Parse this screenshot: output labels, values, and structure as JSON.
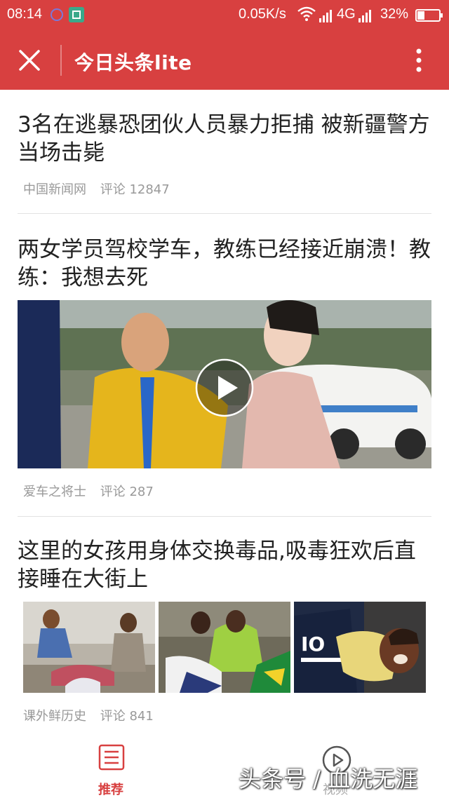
{
  "status_bar": {
    "time": "08:14",
    "network_speed": "0.05K/s",
    "network_type": "4G",
    "battery": "32%",
    "icons": [
      "circle-notification-icon",
      "scan-icon",
      "wifi-icon",
      "signal-icon",
      "battery-icon"
    ]
  },
  "app_bar": {
    "title": "今日头条lite",
    "close_icon": "close-icon",
    "more_icon": "more-vertical-icon",
    "color": "#d84040"
  },
  "articles": [
    {
      "headline": "3名在逃暴恐团伙人员暴力拒捕 被新疆警方当场击毙",
      "source": "中国新闻网",
      "comments": "评论 12847"
    },
    {
      "headline": "两女学员驾校学车，教练已经接近崩溃！教练：我想去死",
      "source": "爱车之将士",
      "comments": "评论 287",
      "media": "video",
      "play_icon": "play-icon"
    },
    {
      "headline": "这里的女孩用身体交换毒品,吸毒狂欢后直接睡在大街上",
      "source": "课外鲜历史",
      "comments": "评论 841",
      "media": "three-images"
    }
  ],
  "tab_bar": {
    "recommend_label": "推荐",
    "video_label": "视频",
    "active_color": "#d84040"
  },
  "watermark": "头条号 / 血洗无涯"
}
